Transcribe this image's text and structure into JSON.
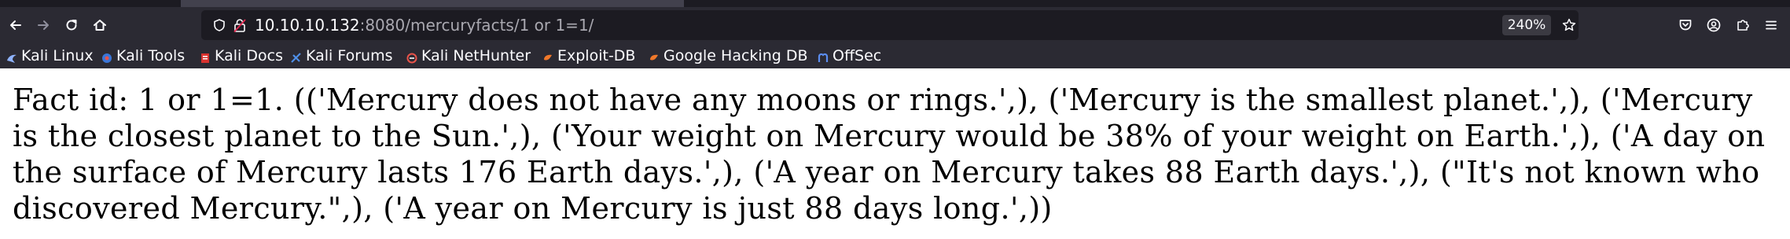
{
  "browser": {
    "url_host": "10.10.10.132",
    "url_path": ":8080/mercuryfacts/1 or 1=1/",
    "zoom": "240%",
    "colors": {
      "chrome_dark": "#1c1b22",
      "toolbar": "#2b2a33",
      "text_light": "#fbfbfe",
      "text_dim": "#a9a8b0"
    }
  },
  "bookmarks": [
    {
      "label": "Kali Linux",
      "icon": "kali-dragon-icon"
    },
    {
      "label": "Kali Tools",
      "icon": "kali-tools-icon"
    },
    {
      "label": "Kali Docs",
      "icon": "kali-docs-icon"
    },
    {
      "label": "Kali Forums",
      "icon": "kali-forums-icon"
    },
    {
      "label": "Kali NetHunter",
      "icon": "kali-nethunter-icon"
    },
    {
      "label": "Exploit-DB",
      "icon": "exploit-db-icon"
    },
    {
      "label": "Google Hacking DB",
      "icon": "google-hacking-db-icon"
    },
    {
      "label": "OffSec",
      "icon": "offsec-icon"
    }
  ],
  "page": {
    "body_text": "Fact id: 1 or 1=1. (('Mercury does not have any moons or rings.',), ('Mercury is the smallest planet.',), ('Mercury is the closest planet to the Sun.',), ('Your weight on Mercury would be 38% of your weight on Earth.',), ('A day on the surface of Mercury lasts 176 Earth days.',), ('A year on Mercury takes 88 Earth days.',), (\"It's not known who discovered Mercury.\",), ('A year on Mercury is just 88 days long.',))"
  }
}
